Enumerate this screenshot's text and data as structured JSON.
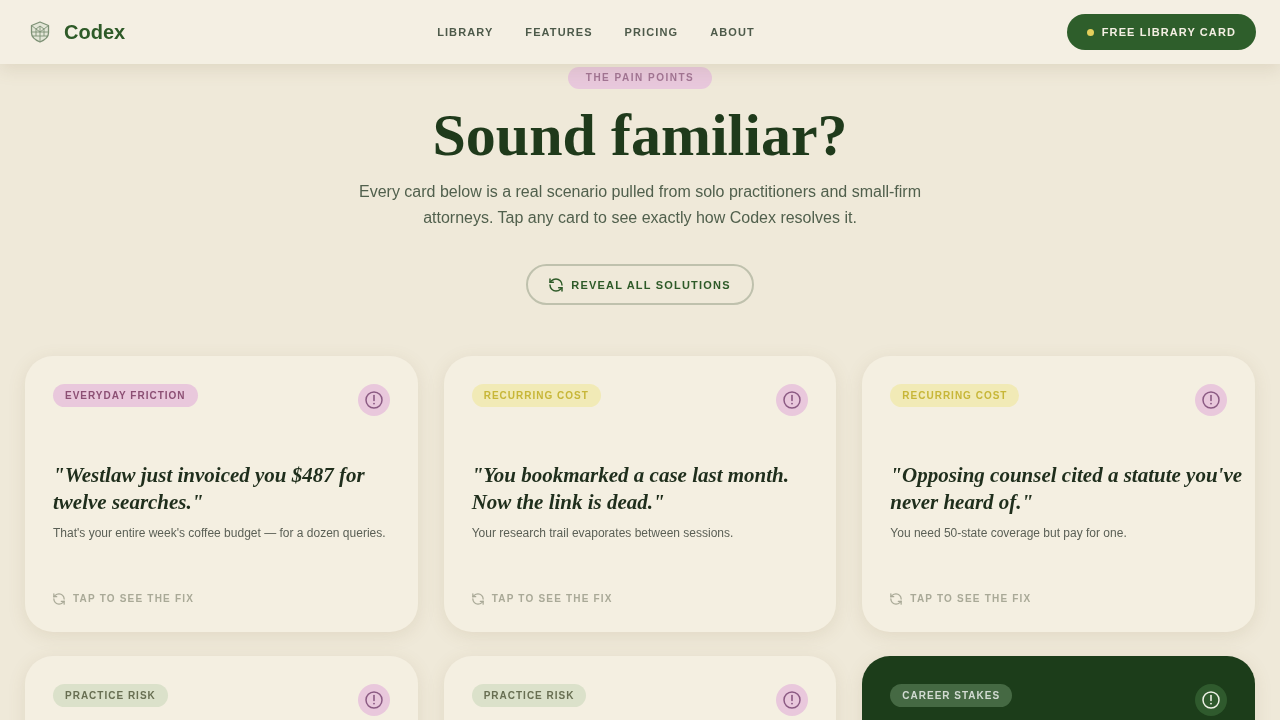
{
  "header": {
    "brand": "Codex",
    "nav": [
      "LIBRARY",
      "FEATURES",
      "PRICING",
      "ABOUT"
    ],
    "cta": {
      "label": "FREE LIBRARY CARD"
    }
  },
  "hero": {
    "eyebrow": "THE PAIN POINTS",
    "title": "Sound familiar?",
    "subtitle": "Every card below is a real scenario pulled from solo practitioners and small-firm attorneys. Tap any card to see exactly how Codex resolves it.",
    "action": {
      "label": "REVEAL ALL SOLUTIONS"
    }
  },
  "cards": [
    {
      "kind": "light",
      "tag": {
        "label": "EVERYDAY FRICTION",
        "color": "#e9c8dc"
      },
      "quote": "\"Westlaw just invoiced you $487 for twelve searches.\"",
      "detail": "That's your entire week's coffee budget — for a dozen queries.",
      "hint": "TAP TO SEE THE FIX"
    },
    {
      "kind": "light",
      "tag": {
        "label": "RECURRING COST",
        "color": "#f1eab6"
      },
      "quote": "\"You bookmarked a case last month. Now the link is dead.\"",
      "detail": "Your research trail evaporates between sessions.",
      "hint": "TAP TO SEE THE FIX"
    },
    {
      "kind": "light",
      "tag": {
        "label": "RECURRING COST",
        "color": "#f1eab6"
      },
      "quote": "\"Opposing counsel cited a statute you've never heard of.\"",
      "detail": "You need 50-state coverage but pay for one.",
      "hint": "TAP TO SEE THE FIX"
    },
    {
      "kind": "light",
      "tag": {
        "label": "PRACTICE RISK",
        "color": "#dbe1ca"
      }
    },
    {
      "kind": "light",
      "tag": {
        "label": "PRACTICE RISK",
        "color": "#dbe1ca"
      }
    },
    {
      "kind": "dark",
      "tag": {
        "label": "CAREER STAKES",
        "color": "#456943"
      }
    }
  ]
}
